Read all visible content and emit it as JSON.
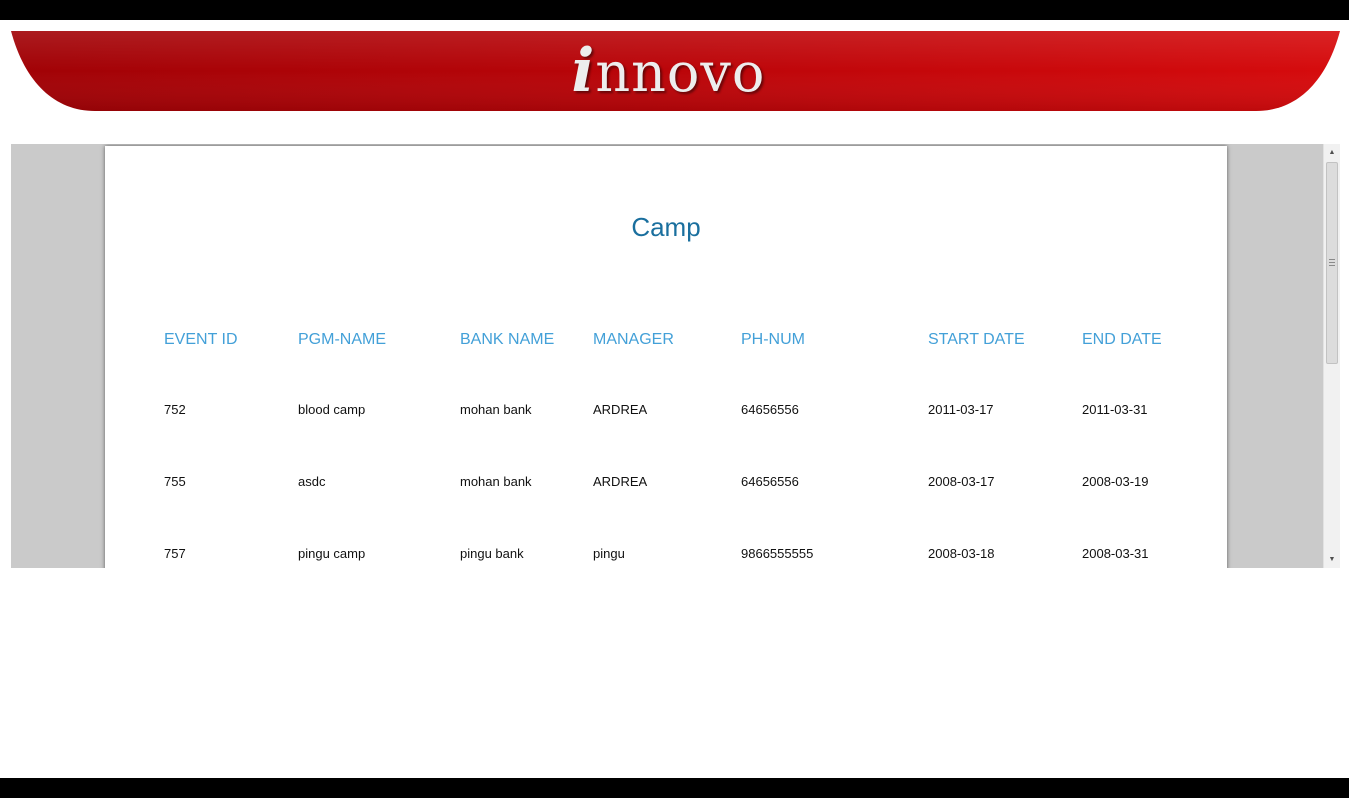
{
  "header": {
    "brand_i": "i",
    "brand_rest": "nnovo",
    "colors": {
      "banner_dark": "#a30006",
      "banner_light": "#d80b0d",
      "top_bar": "#000000"
    }
  },
  "report": {
    "title": "Camp",
    "columns": [
      "EVENT ID",
      "PGM-NAME",
      "BANK NAME",
      "MANAGER",
      "PH-NUM",
      "START DATE",
      "END DATE"
    ],
    "rows": [
      [
        "752",
        "blood camp",
        "mohan bank",
        "ARDREA",
        "64656556",
        "2011-03-17",
        "2011-03-31"
      ],
      [
        "755",
        "asdc",
        "mohan bank",
        "ARDREA",
        "64656556",
        "2008-03-17",
        "2008-03-19"
      ],
      [
        "757",
        "pingu camp",
        "pingu bank",
        "pingu",
        "9866555555",
        "2008-03-18",
        "2008-03-31"
      ]
    ],
    "colors": {
      "title": "#1a6f9e",
      "header_text": "#43a0d8",
      "frame_bg": "#cacaca"
    }
  },
  "scrollbar": {
    "up_icon": "scroll-up-arrow-icon",
    "down_icon": "scroll-down-arrow-icon",
    "scroll_position": 0
  }
}
